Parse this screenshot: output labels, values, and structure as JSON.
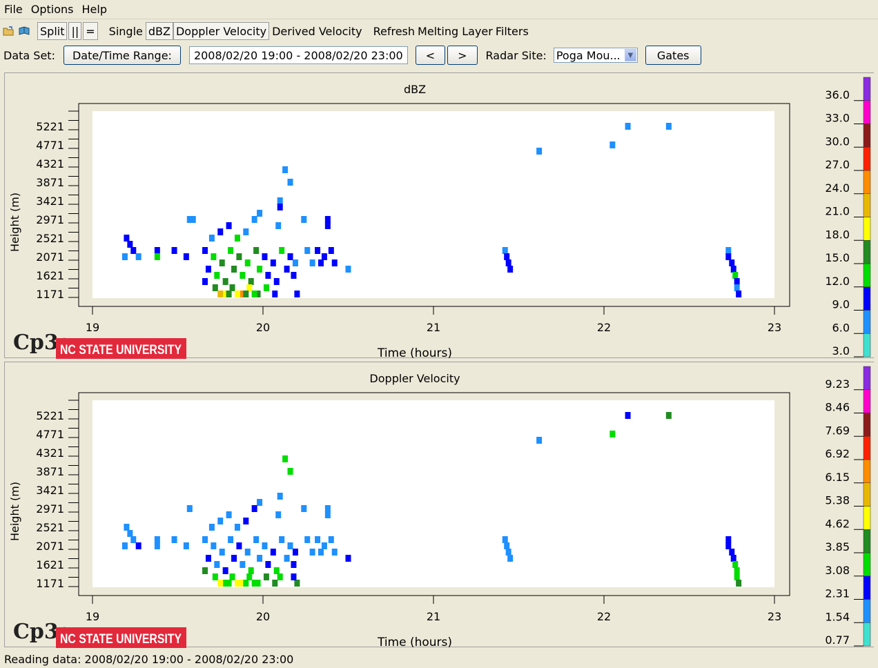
{
  "menu": [
    "File",
    "Options",
    "Help"
  ],
  "toolbar": {
    "icons": [
      "open-folder-icon",
      "open-book-icon"
    ],
    "split_label": "Split",
    "pause_label": "||",
    "equal_label": "=",
    "tabs": [
      "Single",
      "dBZ",
      "Doppler Velocity",
      "Derived Velocity",
      "Refresh",
      "Melting Layer",
      "Filters"
    ]
  },
  "dataset": {
    "label": "Data Set:",
    "range_button": "Date/Time Range:",
    "range_value": "2008/02/20 19:00 - 2008/02/20 23:00",
    "prev_label": "<",
    "next_label": ">",
    "site_label": "Radar Site:",
    "site_value": "Poga Mou...",
    "gates_label": "Gates"
  },
  "logo": {
    "cp3": "Cp3g",
    "university": "NC STATE UNIVERSITY"
  },
  "status": "Reading data: 2008/02/20 19:00 - 2008/02/20 23:00",
  "colors": {
    "scale": [
      "#40e0d0",
      "#1e90ff",
      "#0000ff",
      "#00dd00",
      "#228b22",
      "#ffff00",
      "#e8b800",
      "#ff8c00",
      "#ff2200",
      "#8b1a1a",
      "#ff00cc",
      "#8a2be2"
    ]
  },
  "chart_data": [
    {
      "type": "heatmap",
      "title": "dBZ",
      "xlabel": "Time (hours)",
      "ylabel": "Height (m)",
      "xlim": [
        19,
        23
      ],
      "xticks": [
        19,
        20,
        21,
        22,
        23
      ],
      "yticks": [
        1171,
        1621,
        2071,
        2521,
        2971,
        3421,
        3871,
        4321,
        4771,
        5221
      ],
      "colorbar_labels": [
        "36.0",
        "33.0",
        "30.0",
        "27.0",
        "24.0",
        "21.0",
        "18.0",
        "15.0",
        "12.0",
        "9.0",
        "6.0",
        "3.0"
      ],
      "cells": [
        [
          22.14,
          5221,
          1
        ],
        [
          22.38,
          5221,
          1
        ],
        [
          21.62,
          4621,
          1
        ],
        [
          22.05,
          4771,
          1
        ],
        [
          20.13,
          4171,
          1
        ],
        [
          20.16,
          3871,
          1
        ],
        [
          20.1,
          3421,
          1
        ],
        [
          20.1,
          3271,
          2
        ],
        [
          19.98,
          3121,
          1
        ],
        [
          19.95,
          2971,
          1
        ],
        [
          20.24,
          2971,
          1
        ],
        [
          19.57,
          2971,
          1
        ],
        [
          19.59,
          2971,
          1
        ],
        [
          20.38,
          2971,
          2
        ],
        [
          20.38,
          2821,
          2
        ],
        [
          20.09,
          2821,
          1
        ],
        [
          19.2,
          2521,
          2
        ],
        [
          19.22,
          2371,
          2
        ],
        [
          19.24,
          2221,
          2
        ],
        [
          19.19,
          2071,
          1
        ],
        [
          19.27,
          2071,
          1
        ],
        [
          19.38,
          2221,
          2
        ],
        [
          19.38,
          2071,
          3
        ],
        [
          19.48,
          2221,
          2
        ],
        [
          19.55,
          2071,
          2
        ],
        [
          20.26,
          2221,
          1
        ],
        [
          20.32,
          2221,
          2
        ],
        [
          20.36,
          2071,
          2
        ],
        [
          20.4,
          2221,
          2
        ],
        [
          20.42,
          1921,
          2
        ],
        [
          20.34,
          1921,
          2
        ],
        [
          20.29,
          1921,
          1
        ],
        [
          20.5,
          1771,
          1
        ],
        [
          21.42,
          2221,
          1
        ],
        [
          21.43,
          2071,
          2
        ],
        [
          21.44,
          1921,
          2
        ],
        [
          21.45,
          1771,
          2
        ],
        [
          22.73,
          2221,
          1
        ],
        [
          22.73,
          2071,
          2
        ],
        [
          22.75,
          1921,
          2
        ],
        [
          22.76,
          1771,
          2
        ],
        [
          22.77,
          1621,
          3
        ],
        [
          22.78,
          1471,
          2
        ],
        [
          22.78,
          1321,
          1
        ],
        [
          22.79,
          1171,
          2
        ],
        [
          19.7,
          2521,
          1
        ],
        [
          19.75,
          2671,
          2
        ],
        [
          19.8,
          2821,
          2
        ],
        [
          19.85,
          2521,
          3
        ],
        [
          19.9,
          2671,
          1
        ],
        [
          19.66,
          2221,
          2
        ],
        [
          19.71,
          2071,
          3
        ],
        [
          19.76,
          1921,
          4
        ],
        [
          19.81,
          2221,
          3
        ],
        [
          19.86,
          2071,
          4
        ],
        [
          19.91,
          1921,
          3
        ],
        [
          19.96,
          2221,
          4
        ],
        [
          20.01,
          2071,
          2
        ],
        [
          20.06,
          1921,
          2
        ],
        [
          20.11,
          2221,
          3
        ],
        [
          20.16,
          2071,
          2
        ],
        [
          20.19,
          1921,
          1
        ],
        [
          20.14,
          1771,
          2
        ],
        [
          19.68,
          1771,
          2
        ],
        [
          19.73,
          1621,
          3
        ],
        [
          19.78,
          1471,
          4
        ],
        [
          19.83,
          1771,
          4
        ],
        [
          19.88,
          1621,
          3
        ],
        [
          19.93,
          1471,
          4
        ],
        [
          19.98,
          1771,
          3
        ],
        [
          20.03,
          1621,
          2
        ],
        [
          20.08,
          1471,
          2
        ],
        [
          20.18,
          1621,
          2
        ],
        [
          19.66,
          1471,
          2
        ],
        [
          19.72,
          1321,
          4
        ],
        [
          19.77,
          1171,
          5
        ],
        [
          19.82,
          1321,
          4
        ],
        [
          19.87,
          1171,
          7
        ],
        [
          19.92,
          1321,
          5
        ],
        [
          19.97,
          1171,
          4
        ],
        [
          20.02,
          1321,
          3
        ],
        [
          20.07,
          1171,
          2
        ],
        [
          20.2,
          1171,
          2
        ],
        [
          19.75,
          1171,
          6
        ],
        [
          19.8,
          1171,
          4
        ],
        [
          19.85,
          1171,
          5
        ],
        [
          19.9,
          1171,
          4
        ],
        [
          19.95,
          1171,
          3
        ]
      ]
    },
    {
      "type": "heatmap",
      "title": "Doppler Velocity",
      "xlabel": "Time (hours)",
      "ylabel": "Height (m)",
      "xlim": [
        19,
        23
      ],
      "xticks": [
        19,
        20,
        21,
        22,
        23
      ],
      "yticks": [
        1171,
        1621,
        2071,
        2521,
        2971,
        3421,
        3871,
        4321,
        4771,
        5221
      ],
      "colorbar_labels": [
        "9.23",
        "8.46",
        "7.69",
        "6.92",
        "6.15",
        "5.38",
        "4.62",
        "3.85",
        "3.08",
        "2.31",
        "1.54",
        "0.77"
      ],
      "cells": [
        [
          22.14,
          5221,
          2
        ],
        [
          22.38,
          5221,
          4
        ],
        [
          21.62,
          4621,
          1
        ],
        [
          22.05,
          4771,
          3
        ],
        [
          20.13,
          4171,
          3
        ],
        [
          20.16,
          3871,
          3
        ],
        [
          20.1,
          3271,
          1
        ],
        [
          19.98,
          3121,
          1
        ],
        [
          19.95,
          2971,
          2
        ],
        [
          20.24,
          2971,
          1
        ],
        [
          19.57,
          2971,
          1
        ],
        [
          20.38,
          2971,
          1
        ],
        [
          20.38,
          2821,
          1
        ],
        [
          20.09,
          2821,
          1
        ],
        [
          19.2,
          2521,
          1
        ],
        [
          19.22,
          2371,
          1
        ],
        [
          19.24,
          2221,
          1
        ],
        [
          19.19,
          2071,
          1
        ],
        [
          19.27,
          2071,
          2
        ],
        [
          19.38,
          2221,
          1
        ],
        [
          19.38,
          2071,
          1
        ],
        [
          19.48,
          2221,
          1
        ],
        [
          19.55,
          2071,
          1
        ],
        [
          20.26,
          2221,
          1
        ],
        [
          20.32,
          2221,
          1
        ],
        [
          20.36,
          2071,
          1
        ],
        [
          20.4,
          2221,
          1
        ],
        [
          20.42,
          1921,
          1
        ],
        [
          20.34,
          1921,
          1
        ],
        [
          20.29,
          1921,
          1
        ],
        [
          20.5,
          1771,
          2
        ],
        [
          21.42,
          2221,
          1
        ],
        [
          21.43,
          2071,
          1
        ],
        [
          21.44,
          1921,
          1
        ],
        [
          21.45,
          1771,
          1
        ],
        [
          22.73,
          2221,
          2
        ],
        [
          22.73,
          2071,
          2
        ],
        [
          22.75,
          1921,
          2
        ],
        [
          22.76,
          1771,
          2
        ],
        [
          22.77,
          1621,
          3
        ],
        [
          22.78,
          1471,
          3
        ],
        [
          22.78,
          1321,
          3
        ],
        [
          22.79,
          1171,
          4
        ],
        [
          19.7,
          2521,
          1
        ],
        [
          19.75,
          2671,
          1
        ],
        [
          19.8,
          2821,
          1
        ],
        [
          19.85,
          2521,
          1
        ],
        [
          19.9,
          2671,
          2
        ],
        [
          19.66,
          2221,
          1
        ],
        [
          19.71,
          2071,
          1
        ],
        [
          19.76,
          1921,
          1
        ],
        [
          19.81,
          2221,
          1
        ],
        [
          19.86,
          2071,
          2
        ],
        [
          19.91,
          1921,
          1
        ],
        [
          19.96,
          2221,
          1
        ],
        [
          20.01,
          2071,
          1
        ],
        [
          20.06,
          1921,
          2
        ],
        [
          20.11,
          2221,
          1
        ],
        [
          20.16,
          2071,
          1
        ],
        [
          20.19,
          1921,
          2
        ],
        [
          20.14,
          1771,
          1
        ],
        [
          19.68,
          1771,
          2
        ],
        [
          19.73,
          1621,
          1
        ],
        [
          19.78,
          1471,
          2
        ],
        [
          19.83,
          1771,
          2
        ],
        [
          19.88,
          1621,
          1
        ],
        [
          19.93,
          1471,
          3
        ],
        [
          19.98,
          1771,
          1
        ],
        [
          20.03,
          1621,
          2
        ],
        [
          20.08,
          1471,
          3
        ],
        [
          20.18,
          1621,
          2
        ],
        [
          19.66,
          1471,
          4
        ],
        [
          19.72,
          1321,
          3
        ],
        [
          19.77,
          1171,
          3
        ],
        [
          19.82,
          1321,
          3
        ],
        [
          19.87,
          1171,
          5
        ],
        [
          19.92,
          1321,
          3
        ],
        [
          19.97,
          1171,
          3
        ],
        [
          20.02,
          1321,
          4
        ],
        [
          20.07,
          1171,
          4
        ],
        [
          20.2,
          1171,
          4
        ],
        [
          19.75,
          1171,
          5
        ],
        [
          19.8,
          1171,
          3
        ],
        [
          19.85,
          1171,
          5
        ],
        [
          19.9,
          1171,
          3
        ],
        [
          19.95,
          1171,
          3
        ],
        [
          20.18,
          1321,
          2
        ],
        [
          20.1,
          1321,
          3
        ]
      ]
    }
  ]
}
